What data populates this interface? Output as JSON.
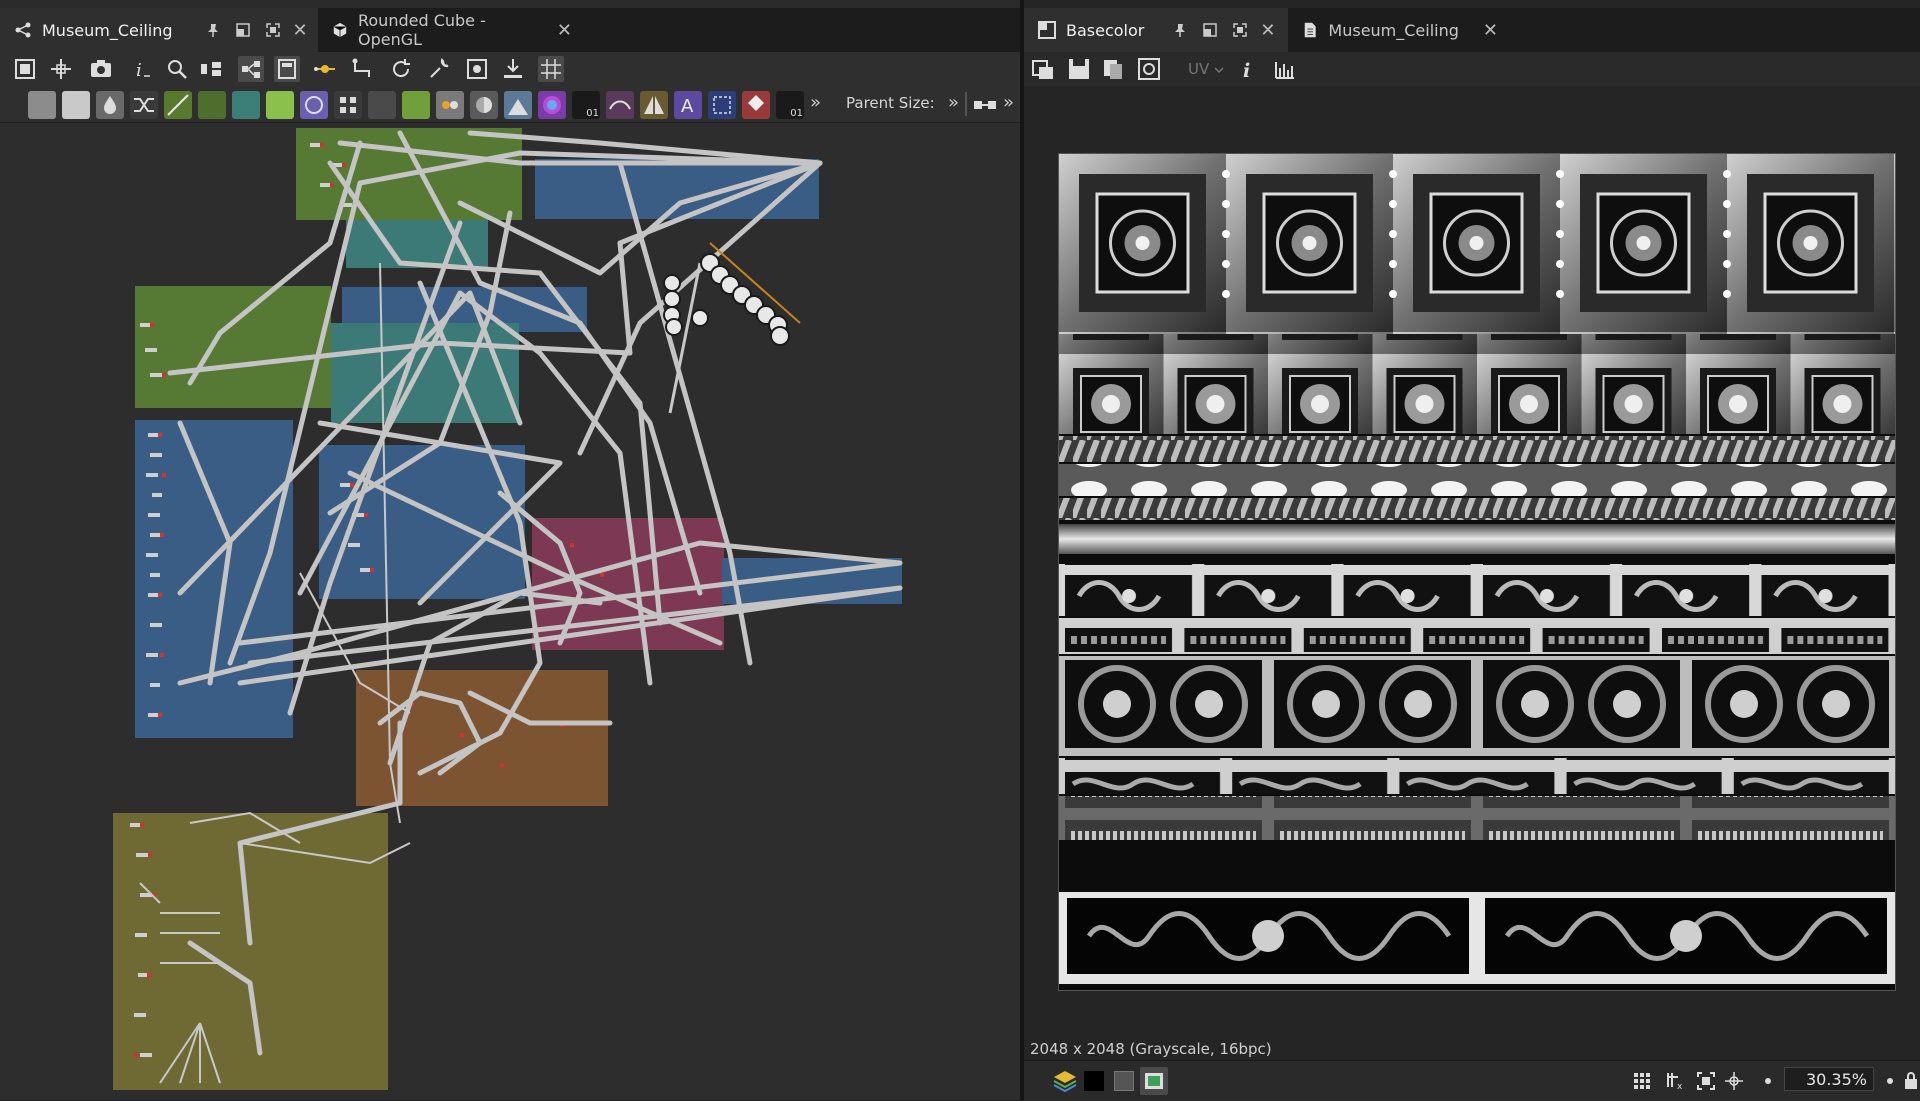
{
  "left_tabs": [
    {
      "label": "Museum_Ceiling"
    },
    {
      "label": "Rounded Cube - OpenGL"
    }
  ],
  "right_tabs": [
    {
      "label": "Basecolor"
    },
    {
      "label": "Museum_Ceiling"
    }
  ],
  "toolbar": {
    "parent_size_label": "Parent Size:",
    "overflow_glyph": "»",
    "uv_label": "UV"
  },
  "node_icons": [
    "01",
    "01"
  ],
  "viewer": {
    "status_text": "2048 x 2048 (Grayscale, 16bpc)",
    "zoom_value": "30.35%"
  },
  "frame_colors": {
    "green": "#567a33",
    "teal": "#3c7a78",
    "blue": "#3a5d86",
    "pink": "#7d3854",
    "orange": "#7d5432",
    "olive": "#6f6a33",
    "accent_orange": "#c8821e"
  },
  "icons": [
    "graph-icon",
    "pin-icon",
    "float-icon",
    "maximize-icon",
    "close-icon",
    "cube-icon",
    "frame-icon",
    "pan-icon",
    "camera-icon",
    "info-icon",
    "search-icon",
    "layout-icon",
    "link-icon",
    "refresh-icon",
    "tools-icon",
    "export-icon",
    "grid-icon",
    "image-node-icon",
    "copy-icon",
    "save-icon",
    "histogram-icon",
    "layers-icon",
    "fit-icon",
    "lock-icon"
  ]
}
